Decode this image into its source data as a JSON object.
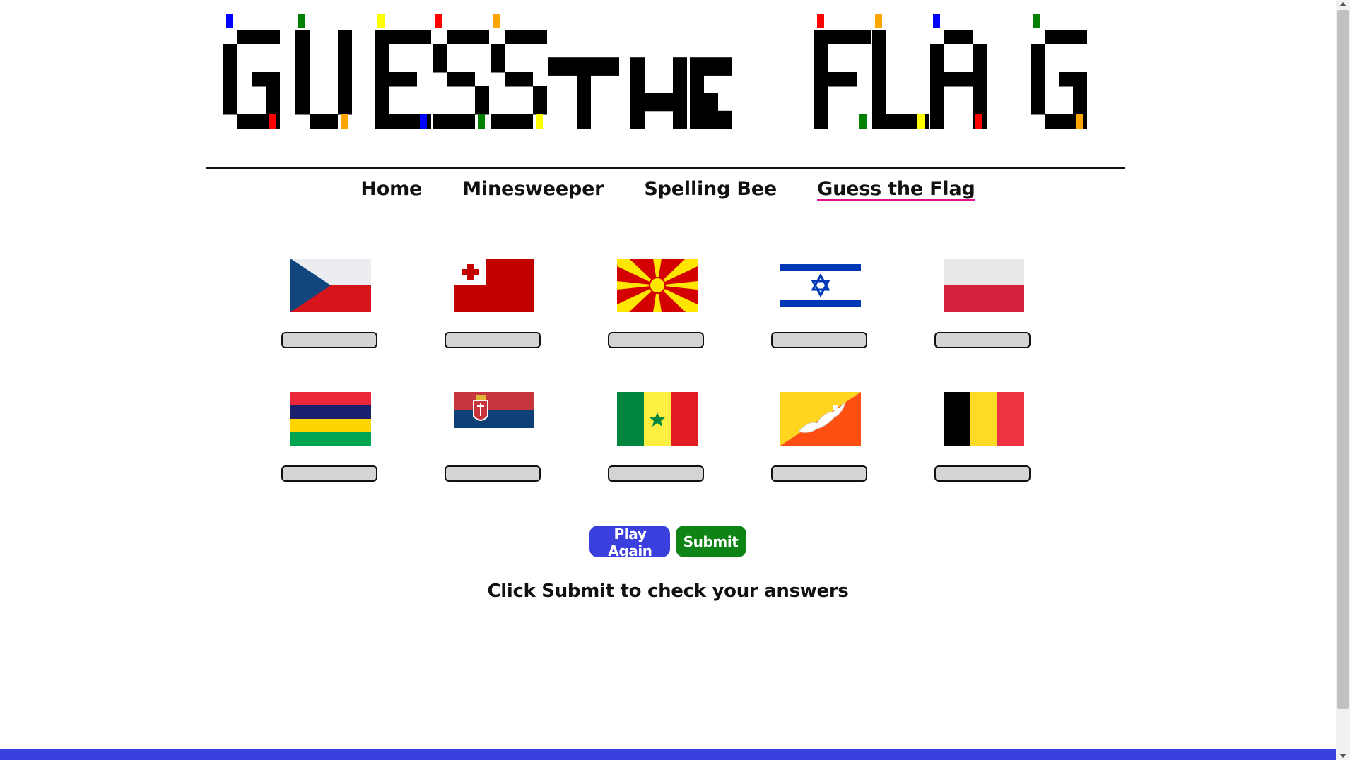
{
  "logo": {
    "text": "GUESS THE FLAG",
    "ink": "#000000",
    "accents": [
      "#0000ff",
      "#ff0000",
      "#008000",
      "#ffa500",
      "#ffff00"
    ]
  },
  "nav": {
    "items": [
      {
        "label": "Home",
        "active": false
      },
      {
        "label": "Minesweeper",
        "active": false
      },
      {
        "label": "Spelling Bee",
        "active": false
      },
      {
        "label": "Guess the Flag",
        "active": true
      }
    ],
    "active_underline": "#e8108a"
  },
  "flags": [
    {
      "flag_icon": "czech-republic-flag-icon",
      "answer": ""
    },
    {
      "flag_icon": "tonga-flag-icon",
      "answer": ""
    },
    {
      "flag_icon": "north-macedonia-flag-icon",
      "answer": ""
    },
    {
      "flag_icon": "israel-flag-icon",
      "answer": ""
    },
    {
      "flag_icon": "poland-flag-icon",
      "answer": ""
    },
    {
      "flag_icon": "mauritius-flag-icon",
      "answer": ""
    },
    {
      "flag_icon": "serbia-flag-icon",
      "answer": ""
    },
    {
      "flag_icon": "senegal-flag-icon",
      "answer": ""
    },
    {
      "flag_icon": "bhutan-flag-icon",
      "answer": ""
    },
    {
      "flag_icon": "belgium-flag-icon",
      "answer": ""
    }
  ],
  "buttons": {
    "play_again": "Play Again",
    "submit": "Submit",
    "play_again_color": "#3a3fde",
    "submit_color": "#0f8416"
  },
  "status": "Click Submit to check your answers",
  "footer_color": "#3a3fde"
}
